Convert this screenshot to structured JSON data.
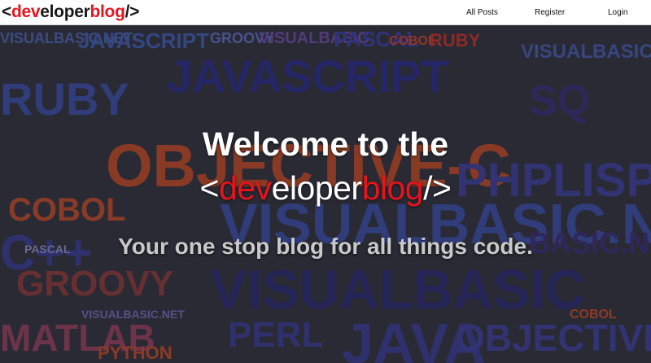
{
  "navbar": {
    "brand": {
      "open": "<",
      "part1": "dev",
      "part2": "eloper",
      "part3": "blog",
      "close": "/>"
    },
    "links": [
      "All Posts",
      "Register",
      "Login"
    ]
  },
  "hero": {
    "heading": "Welcome to the",
    "brand": {
      "open": "<",
      "part1": "dev",
      "part2": "eloper",
      "part3": "blog",
      "close": "/>"
    },
    "tagline": "Your one stop blog for all things code."
  },
  "word_cloud": [
    "VISUALBASIC.NET",
    "JAVASCRIPT",
    "GROOVY",
    "VISUALBASIC",
    "PASCAL",
    "COBOL",
    "RUBY",
    "PERL",
    "VISUALBASIC.NET",
    "JAVASCRIPT",
    "SQL",
    "LISP",
    "OBJECTIVE-C",
    "PYTHON",
    "PHP",
    "MATLAB",
    "JAVA",
    "C",
    "C++",
    "VISUALBASIC.NET",
    "GROOVY",
    "OBJECTIVE-C",
    "PERL",
    "PHPLISP",
    "COBOL",
    "PASCAL"
  ],
  "colors": {
    "accent": "#e8141d",
    "brand_dark": "#1a1a1a"
  }
}
